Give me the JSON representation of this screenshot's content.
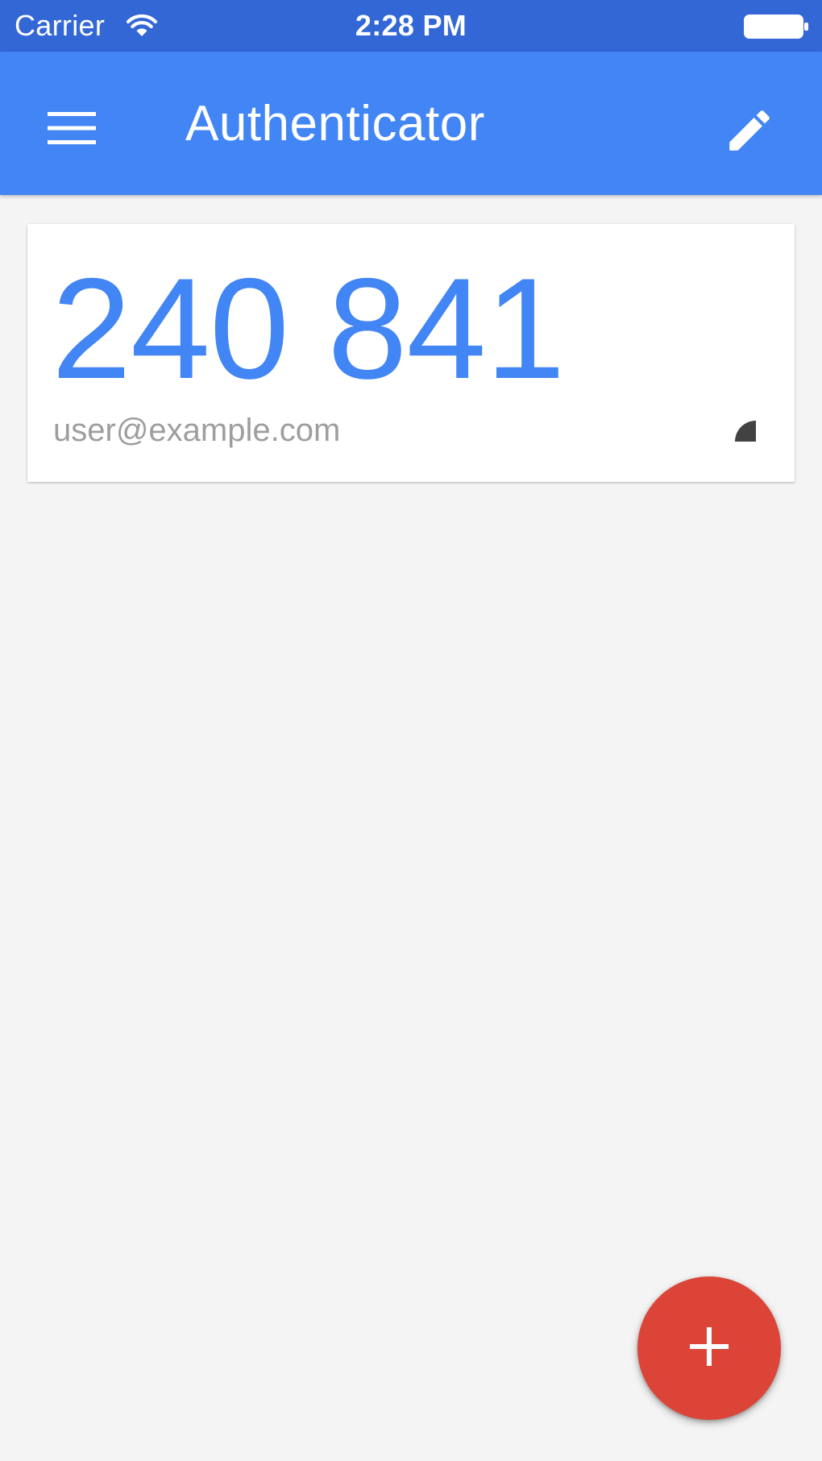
{
  "status_bar": {
    "carrier": "Carrier",
    "time": "2:28 PM",
    "wifi_icon": "wifi-icon",
    "battery_icon": "battery-full-icon",
    "background_color": "#3367d6"
  },
  "app_bar": {
    "title": "Authenticator",
    "menu_icon": "hamburger-menu-icon",
    "edit_icon": "pencil-edit-icon",
    "background_color": "#4285f4"
  },
  "accounts": [
    {
      "code": "240 841",
      "label": "user@example.com",
      "timer_icon": "countdown-pie-icon",
      "timer_remaining_fraction": 0.25
    }
  ],
  "fab": {
    "icon": "plus-icon",
    "color": "#db4437"
  },
  "colors": {
    "accent": "#4285f4",
    "background": "#f4f4f4",
    "label_gray": "#9e9e9e"
  }
}
